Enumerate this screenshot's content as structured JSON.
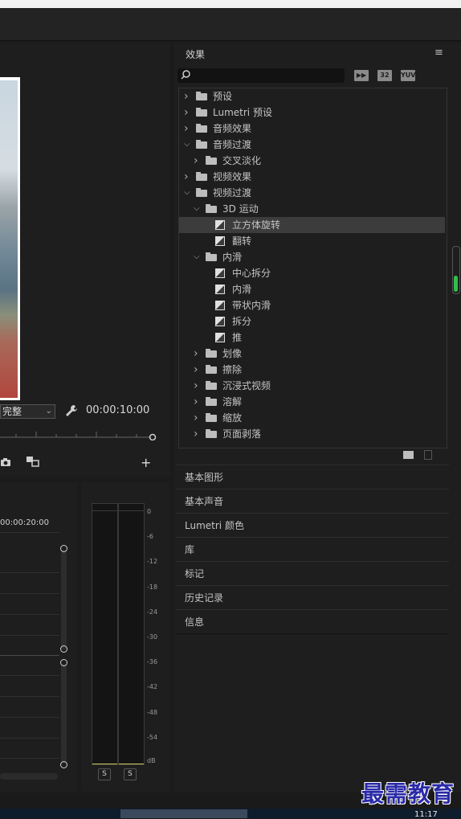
{
  "program_monitor": {
    "fit_value": "完整",
    "timecode": "00:00:10:00"
  },
  "timeline": {
    "timecode": "00:00:20:00"
  },
  "audio_meter": {
    "db_ticks": [
      "0",
      "-6",
      "-12",
      "-18",
      "-24",
      "-30",
      "-36",
      "-42",
      "-48",
      "-54",
      "dB"
    ],
    "solo_labels": [
      "S",
      "S"
    ]
  },
  "effects_panel": {
    "title": "效果",
    "menu_icon": "menu-icon",
    "search_placeholder": "",
    "badges": [
      "accelerated-effects-icon",
      "32",
      "YUV"
    ],
    "tree": [
      {
        "label": "预设",
        "depth": 0,
        "expanded": false,
        "kind": "preset-folder"
      },
      {
        "label": "Lumetri 预设",
        "depth": 0,
        "expanded": false,
        "kind": "preset-folder"
      },
      {
        "label": "音频效果",
        "depth": 0,
        "expanded": false,
        "kind": "folder"
      },
      {
        "label": "音频过渡",
        "depth": 0,
        "expanded": true,
        "kind": "folder"
      },
      {
        "label": "交叉淡化",
        "depth": 1,
        "expanded": false,
        "kind": "folder"
      },
      {
        "label": "视频效果",
        "depth": 0,
        "expanded": false,
        "kind": "folder"
      },
      {
        "label": "视频过渡",
        "depth": 0,
        "expanded": true,
        "kind": "folder"
      },
      {
        "label": "3D 运动",
        "depth": 1,
        "expanded": true,
        "kind": "folder"
      },
      {
        "label": "立方体旋转",
        "depth": 2,
        "kind": "effect",
        "selected": true
      },
      {
        "label": "翻转",
        "depth": 2,
        "kind": "effect"
      },
      {
        "label": "内滑",
        "depth": 1,
        "expanded": true,
        "kind": "folder"
      },
      {
        "label": "中心拆分",
        "depth": 2,
        "kind": "effect"
      },
      {
        "label": "内滑",
        "depth": 2,
        "kind": "effect"
      },
      {
        "label": "带状内滑",
        "depth": 2,
        "kind": "effect"
      },
      {
        "label": "拆分",
        "depth": 2,
        "kind": "effect"
      },
      {
        "label": "推",
        "depth": 2,
        "kind": "effect"
      },
      {
        "label": "划像",
        "depth": 1,
        "expanded": false,
        "kind": "folder"
      },
      {
        "label": "擦除",
        "depth": 1,
        "expanded": false,
        "kind": "folder"
      },
      {
        "label": "沉浸式视频",
        "depth": 1,
        "expanded": false,
        "kind": "folder"
      },
      {
        "label": "溶解",
        "depth": 1,
        "expanded": false,
        "kind": "folder"
      },
      {
        "label": "缩放",
        "depth": 1,
        "expanded": false,
        "kind": "folder"
      },
      {
        "label": "页面剥落",
        "depth": 1,
        "expanded": false,
        "kind": "folder"
      }
    ]
  },
  "panels": [
    "基本图形",
    "基本声音",
    "Lumetri 颜色",
    "库",
    "标记",
    "历史记录",
    "信息"
  ],
  "taskbar": {
    "clock": "11:17"
  },
  "watermark": "最需教育",
  "colors": {
    "panel_bg": "#1e1e1e",
    "selected_row": "#3c3c3c",
    "meter_green": "#2fbf4a",
    "watermark": "#2a2aa8"
  }
}
